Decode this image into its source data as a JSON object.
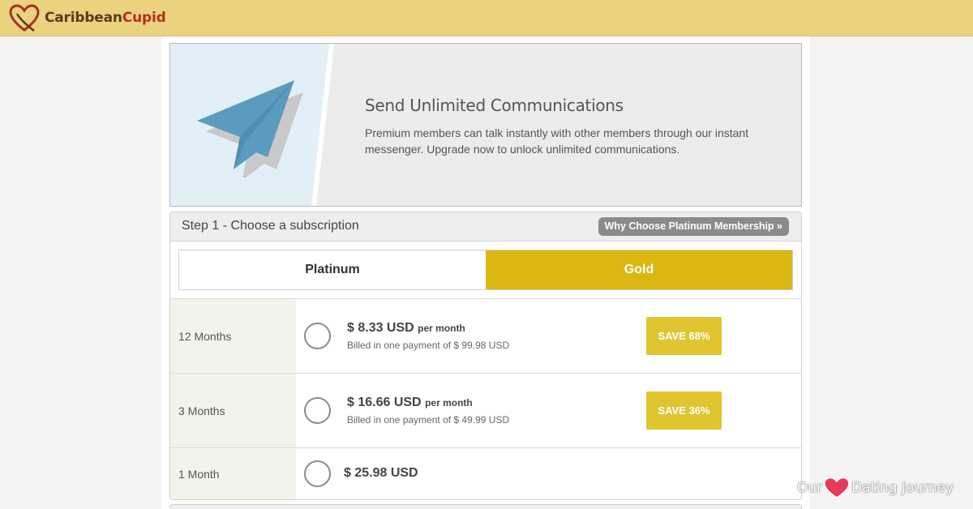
{
  "brand": {
    "name_part1": "Caribbean",
    "name_part2": "Cupid"
  },
  "hero": {
    "title": "Send Unlimited Communications",
    "description": "Premium members can talk instantly with other members through our instant messenger. Upgrade now to unlock unlimited communications."
  },
  "subscription": {
    "step_title": "Step 1 - Choose a subscription",
    "why_button": "Why Choose Platinum Membership »",
    "tabs": [
      {
        "label": "Platinum",
        "selected": false
      },
      {
        "label": "Gold",
        "selected": true
      }
    ],
    "plans": [
      {
        "term": "12 Months",
        "price": "$ 8.33 USD",
        "per": "per month",
        "billed": "Billed in one payment of $ 99.98 USD",
        "save": "SAVE 68%"
      },
      {
        "term": "3 Months",
        "price": "$ 16.66 USD",
        "per": "per month",
        "billed": "Billed in one payment of $ 49.99 USD",
        "save": "SAVE 36%"
      },
      {
        "term": "1 Month",
        "price": "$ 25.98 USD"
      }
    ]
  },
  "watermark": {
    "left": "Our",
    "right": "Dating Journey"
  },
  "colors": {
    "topbar": "#ead27f",
    "gold_tab": "#dab811",
    "save_badge": "#e0c531",
    "plane": "#5b9bbf"
  },
  "icons": [
    "heart-logo-icon",
    "paper-plane-icon",
    "heart-icon"
  ]
}
